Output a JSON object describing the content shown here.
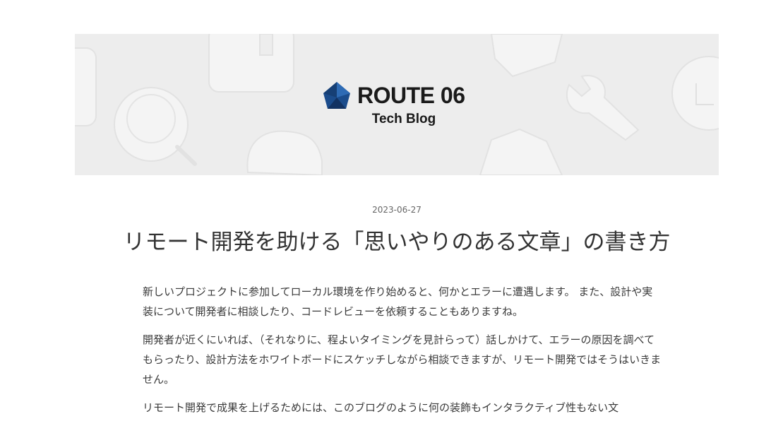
{
  "header": {
    "brand_name": "ROUTE 06",
    "brand_sub": "Tech Blog",
    "logo_color": "#1b4c8c"
  },
  "post": {
    "date": "2023-06-27",
    "title": "リモート開発を助ける「思いやりのある文章」の書き方",
    "paragraphs": [
      "新しいプロジェクトに参加してローカル環境を作り始めると、何かとエラーに遭遇します。 また、設計や実装について開発者に相談したり、コードレビューを依頼することもありますね。",
      "開発者が近くにいれば、（それなりに、程よいタイミングを見計らって）話しかけて、エラーの原因を調べてもらったり、設計方法をホワイトボードにスケッチしながら相談できますが、リモート開発ではそうはいきません。",
      "リモート開発で成果を上げるためには、このブログのように何の装飾もインタラクティブ性もない文"
    ]
  }
}
